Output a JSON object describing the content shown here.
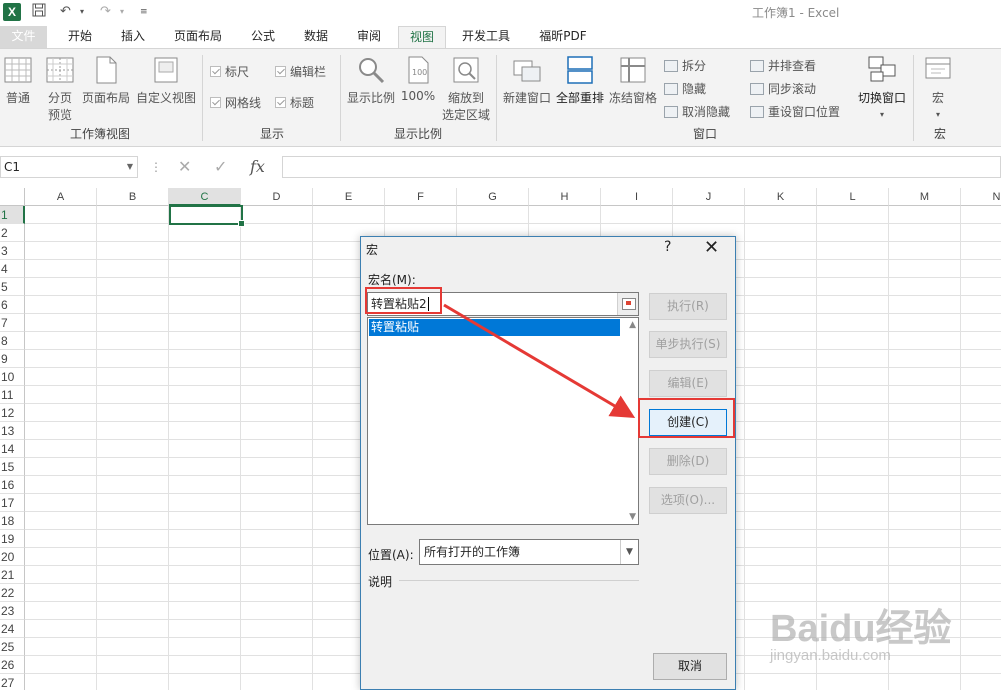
{
  "title": {
    "app_title": "工作簿1 - Excel",
    "logo": "X"
  },
  "qat": {
    "undo": "↶",
    "redo": "↷",
    "customize": "≡"
  },
  "tabs": [
    "文件",
    "开始",
    "插入",
    "页面布局",
    "公式",
    "数据",
    "审阅",
    "视图",
    "开发工具",
    "福昕PDF"
  ],
  "ribbon": {
    "workbook_views": {
      "label": "工作簿视图",
      "normal": "普通",
      "page_break": [
        "分页",
        "预览"
      ],
      "page_layout": "页面布局",
      "custom": "自定义视图"
    },
    "show": {
      "label": "显示",
      "ruler": "标尺",
      "formula_bar": "编辑栏",
      "gridlines": "网格线",
      "headings": "标题"
    },
    "zoom": {
      "label": "显示比例",
      "zoom": "显示比例",
      "hundred": "100%",
      "zoom_sel": [
        "缩放到",
        "选定区域"
      ]
    },
    "window": {
      "label": "窗口",
      "new_window": "新建窗口",
      "arrange_all": "全部重排",
      "freeze": "冻结窗格",
      "split": "拆分",
      "hide": "隐藏",
      "unhide": "取消隐藏",
      "side_by_side": "并排查看",
      "sync_scroll": "同步滚动",
      "reset_pos": "重设窗口位置",
      "switch": "切换窗口"
    },
    "macros": {
      "label": "宏",
      "macros": "宏"
    }
  },
  "formula_bar": {
    "name_box": "C1",
    "cancel": "✕",
    "enter": "✓",
    "fx": "fx",
    "value": ""
  },
  "grid": {
    "columns": [
      "A",
      "B",
      "C",
      "D",
      "E",
      "F",
      "G",
      "H",
      "I",
      "J",
      "K",
      "L",
      "M",
      "N"
    ],
    "selected_column": "C",
    "rows": [
      "1",
      "2",
      "3",
      "4",
      "5",
      "6",
      "7",
      "8",
      "9",
      "10",
      "11",
      "12",
      "13",
      "14",
      "15",
      "16",
      "17",
      "18",
      "19",
      "20",
      "21",
      "22",
      "23",
      "24",
      "25",
      "26",
      "27"
    ],
    "selected_row": "1"
  },
  "dialog": {
    "title": "宏",
    "help": "?",
    "close": "✕",
    "macro_name_label": "宏名(M):",
    "macro_name_value": "转置粘贴2",
    "list_items": [
      "转置粘贴"
    ],
    "buttons": {
      "run": "执行(R)",
      "step": "单步执行(S)",
      "edit": "编辑(E)",
      "create": "创建(C)",
      "delete": "删除(D)",
      "options": "选项(O)..."
    },
    "location_label": "位置(A):",
    "location_value": "所有打开的工作簿",
    "description_label": "说明",
    "cancel": "取消"
  },
  "watermark": {
    "main": "Baidu经验",
    "sub": "jingyan.baidu.com"
  },
  "colors": {
    "excel_green": "#217346",
    "selection_blue": "#0078d7",
    "annotation_red": "#e53935"
  }
}
